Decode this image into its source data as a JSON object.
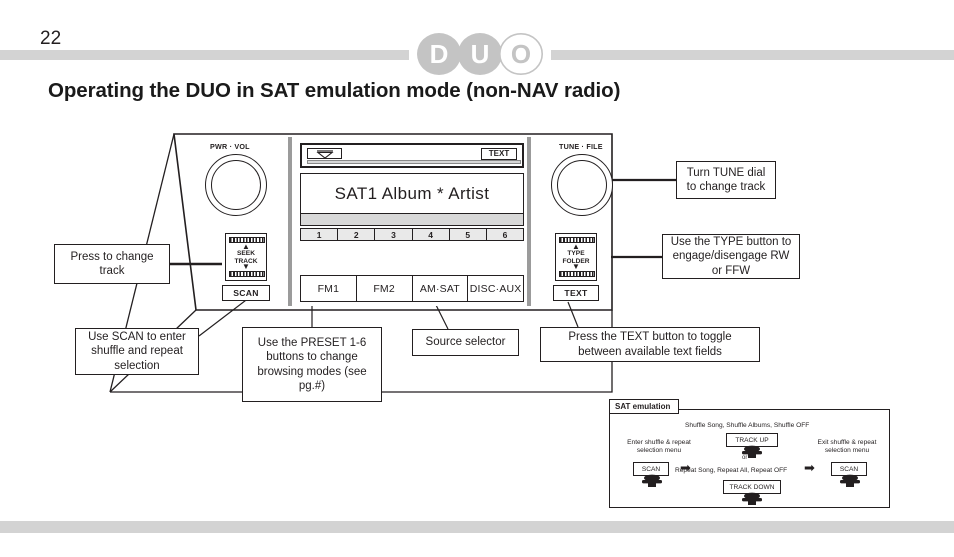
{
  "header": {
    "page_number": "22",
    "logo_letters": [
      "D",
      "U",
      "O"
    ],
    "title": "Operating the DUO in SAT emulation mode (non-NAV radio)",
    "rule_color": "#d3d3d3",
    "logo_color": "#c4c4c4"
  },
  "radio": {
    "left_knob_label": "PWR · VOL",
    "right_knob_label": "TUNE · FILE",
    "seek_rocker": {
      "line1": "SEEK",
      "line2": "TRACK",
      "up": "▲",
      "down": "▼"
    },
    "type_rocker": {
      "line1": "TYPE",
      "line2": "FOLDER",
      "up": "▲",
      "down": "▼"
    },
    "scan_button": "SCAN",
    "text_button_bottom": "TEXT",
    "text_chip": "TEXT",
    "eject_icon": "eject-icon",
    "lcd_text": "SAT1  Album * Artist",
    "presets": [
      "1",
      "2",
      "3",
      "4",
      "5",
      "6"
    ],
    "source_buttons": [
      "FM1",
      "FM2",
      "AM·SAT",
      "DISC·AUX"
    ]
  },
  "callouts": {
    "press_track": "Press to change track",
    "use_scan": "Use SCAN to enter shuffle and repeat selection",
    "use_preset": "Use the PRESET  1-6 buttons to change browsing modes (see pg.#)",
    "source_selector": "Source selector",
    "press_text": "Press the TEXT button to toggle between available text fields",
    "turn_tune": "Turn TUNE dial to change track",
    "use_type": "Use the TYPE button to engage/disengage RW or FFW"
  },
  "sat_panel": {
    "tab_label": "SAT emulation",
    "shuffle_line": "Shuffle Song, Shuffle Albums, Shuffle OFF",
    "repeat_line": "Repeat Song, Repeat All, Repeat OFF",
    "or_label": "or",
    "enter_label": "Enter shuffle & repeat selection menu",
    "exit_label": "Exit shuffle & repeat selection menu",
    "key_scan_left": "SCAN",
    "key_scan_right": "SCAN",
    "key_track_up": "TRACK UP",
    "key_track_down": "TRACK DOWN",
    "arrow_glyph": "➡"
  }
}
